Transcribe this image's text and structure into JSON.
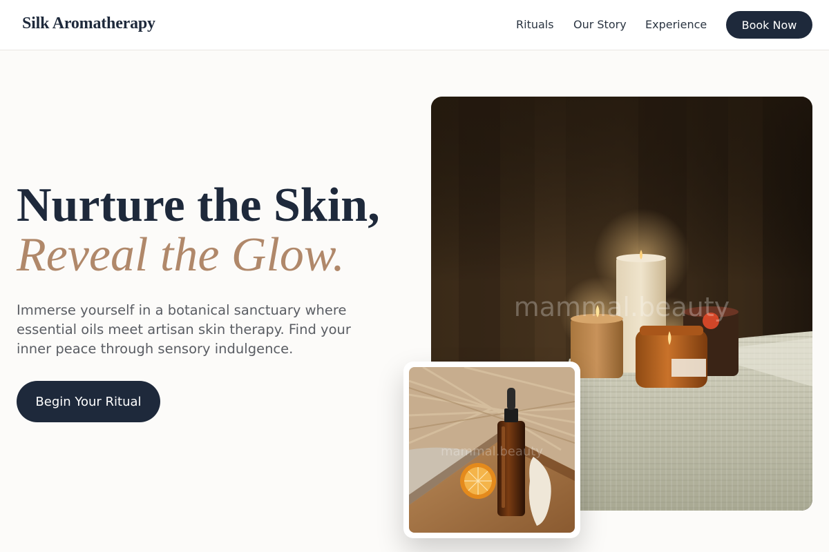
{
  "header": {
    "brand": "Silk Aromatherapy",
    "nav": [
      "Rituals",
      "Our Story",
      "Experience"
    ],
    "book_label": "Book Now"
  },
  "hero": {
    "headline_line1": "Nurture the Skin,",
    "headline_line2": "Reveal the Glow.",
    "subtext": "Immerse yourself in a botanical sanctuary where essential oils meet artisan skin therapy. Find your inner peace through sensory indulgence.",
    "cta_label": "Begin Your Ritual"
  },
  "images": {
    "main_watermark": "mammal.beauty",
    "inset_watermark": "mammal.beauty"
  },
  "colors": {
    "navy": "#1e293b",
    "accent": "#b0886a",
    "background": "#fcfbf9"
  }
}
